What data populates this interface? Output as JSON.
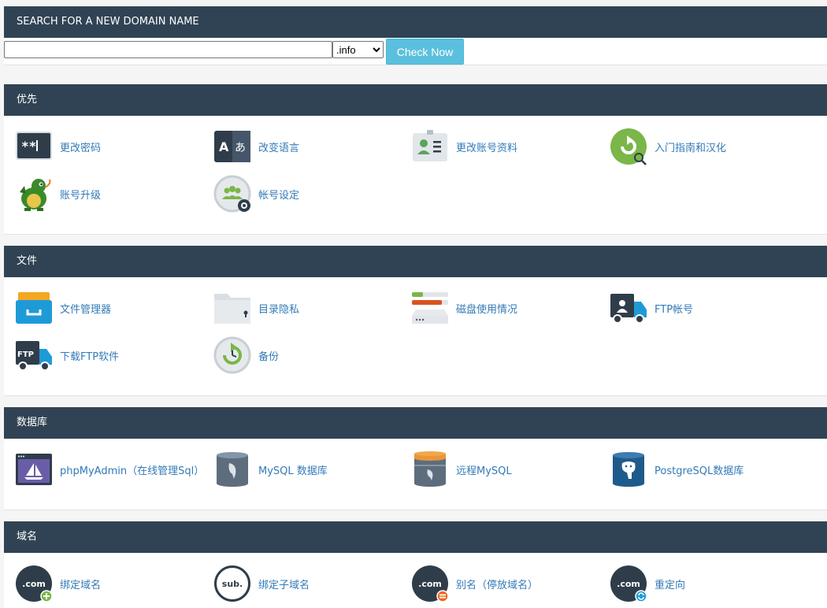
{
  "search": {
    "header": "SEARCH FOR A NEW DOMAIN NAME",
    "input_value": "",
    "tld_selected": ".info",
    "button_label": "Check Now"
  },
  "sections": {
    "preferences": {
      "title": "优先",
      "items": [
        {
          "label": "更改密码",
          "icon": "password-icon"
        },
        {
          "label": "改变语言",
          "icon": "language-icon"
        },
        {
          "label": "更改账号资料",
          "icon": "contact-info-icon"
        },
        {
          "label": "入门指南和汉化",
          "icon": "getting-started-icon"
        },
        {
          "label": "账号升级",
          "icon": "dragon-icon"
        },
        {
          "label": "帐号设定",
          "icon": "user-manager-icon"
        }
      ]
    },
    "files": {
      "title": "文件",
      "items": [
        {
          "label": "文件管理器",
          "icon": "file-manager-icon"
        },
        {
          "label": "目录隐私",
          "icon": "directory-privacy-icon"
        },
        {
          "label": "磁盘使用情况",
          "icon": "disk-usage-icon"
        },
        {
          "label": "FTP帐号",
          "icon": "ftp-accounts-icon"
        },
        {
          "label": "下载FTP软件",
          "icon": "ftp-download-icon"
        },
        {
          "label": "备份",
          "icon": "backup-icon"
        }
      ]
    },
    "databases": {
      "title": "数据库",
      "items": [
        {
          "label": "phpMyAdmin（在线管理Sql）",
          "icon": "phpmyadmin-icon"
        },
        {
          "label": "MySQL 数据库",
          "icon": "mysql-icon"
        },
        {
          "label": "远程MySQL",
          "icon": "remote-mysql-icon"
        },
        {
          "label": "PostgreSQL数据库",
          "icon": "postgresql-icon"
        }
      ]
    },
    "domains": {
      "title": "域名",
      "items": [
        {
          "label": "绑定域名",
          "icon": "addon-domain-icon"
        },
        {
          "label": "绑定子域名",
          "icon": "subdomain-icon"
        },
        {
          "label": "别名（停放域名）",
          "icon": "alias-domain-icon"
        },
        {
          "label": "重定向",
          "icon": "redirect-icon"
        }
      ]
    }
  },
  "colors": {
    "header_bg": "#304354",
    "link": "#337ab7",
    "button": "#5bc0de"
  }
}
